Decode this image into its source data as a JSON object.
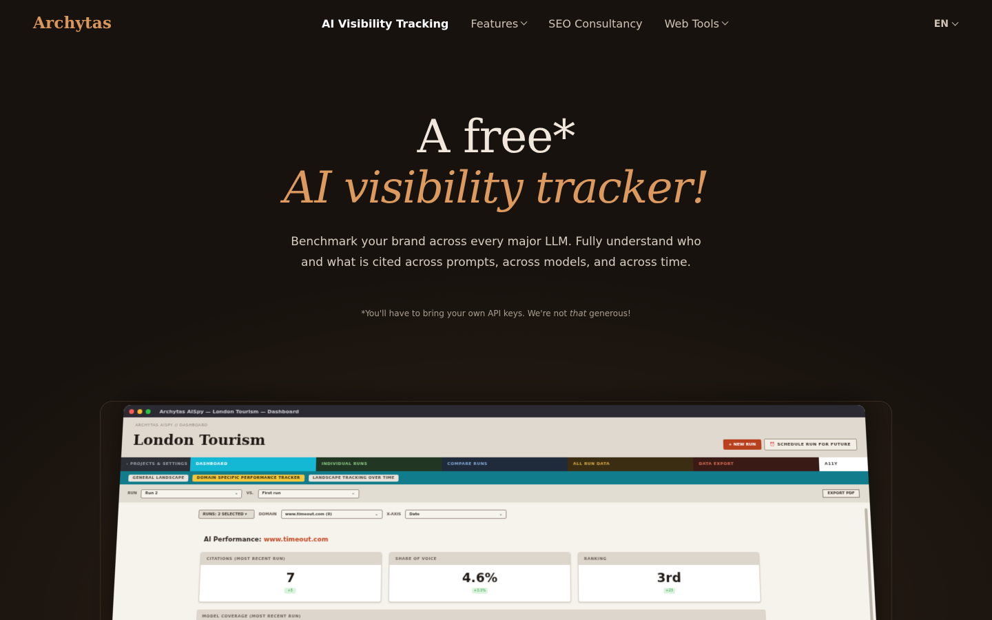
{
  "nav": {
    "logo": "Archytas",
    "links": [
      {
        "label": "AI Visibility Tracking",
        "active": true,
        "dropdown": false
      },
      {
        "label": "Features",
        "active": false,
        "dropdown": true
      },
      {
        "label": "SEO Consultancy",
        "active": false,
        "dropdown": false
      },
      {
        "label": "Web Tools",
        "active": false,
        "dropdown": true
      }
    ],
    "lang": "EN"
  },
  "hero": {
    "line1": "A free*",
    "line2": "AI visibility tracker!",
    "subtitle": "Benchmark your brand across every major LLM. Fully understand who and what is cited across prompts, across models, and across time.",
    "note_before": "*You'll have to bring your own API keys. We're not ",
    "note_em": "that",
    "note_after": " generous!"
  },
  "app": {
    "window_title": "Archytas AISpy — London Tourism — Dashboard",
    "breadcrumb": "ARCHYTAS AISPY // DASHBOARD",
    "project_title": "London Tourism",
    "new_run": "+ NEW RUN",
    "schedule": "⏰ SCHEDULE RUN FOR FUTURE",
    "tabs": [
      {
        "label": "‹ PROJECTS & SETTINGS",
        "bg": "#2c2f36",
        "fg": "#9ea3ac"
      },
      {
        "label": "DASHBOARD",
        "bg": "#15b8d4",
        "fg": "#ffffff"
      },
      {
        "label": "INDIVIDUAL RUNS",
        "bg": "#223624",
        "fg": "#8fcf86"
      },
      {
        "label": "COMPARE RUNS",
        "bg": "#1f2a3a",
        "fg": "#8ab0e0"
      },
      {
        "label": "ALL RUN DATA",
        "bg": "#3a2d12",
        "fg": "#e2b24a"
      },
      {
        "label": "DATA EXPORT",
        "bg": "#3a1a14",
        "fg": "#e0705a"
      },
      {
        "label": "A11Y",
        "bg": "#ffffff",
        "fg": "#333333"
      }
    ],
    "subtabs": [
      {
        "label": "GENERAL LANDSCAPE",
        "on": false
      },
      {
        "label": "DOMAIN SPECIFIC PERFORMANCE TRACKER",
        "on": true
      },
      {
        "label": "LANDSCAPE TRACKING OVER TIME",
        "on": false
      }
    ],
    "run_label": "RUN",
    "run_value": "Run 2",
    "vs_label": "VS.",
    "vs_value": "First run",
    "export": "EXPORT PDF",
    "runs_selected": "RUNS: 2 SELECTED ▾",
    "domain_label": "DOMAIN",
    "domain_value": "www.timeout.com (9)",
    "xaxis_label": "X-AXIS",
    "xaxis_value": "Date",
    "perf_label": "AI Performance: ",
    "perf_domain": "www.timeout.com",
    "cards": [
      {
        "header": "CITATIONS (MOST RECENT RUN)",
        "value": "7",
        "delta": "+5"
      },
      {
        "header": "SHARE OF VOICE",
        "value": "4.6%",
        "delta": "+3.3%"
      },
      {
        "header": "RANKING",
        "value": "3rd",
        "delta": "+23"
      }
    ],
    "coverage": "MODEL COVERAGE (MOST RECENT RUN)"
  }
}
